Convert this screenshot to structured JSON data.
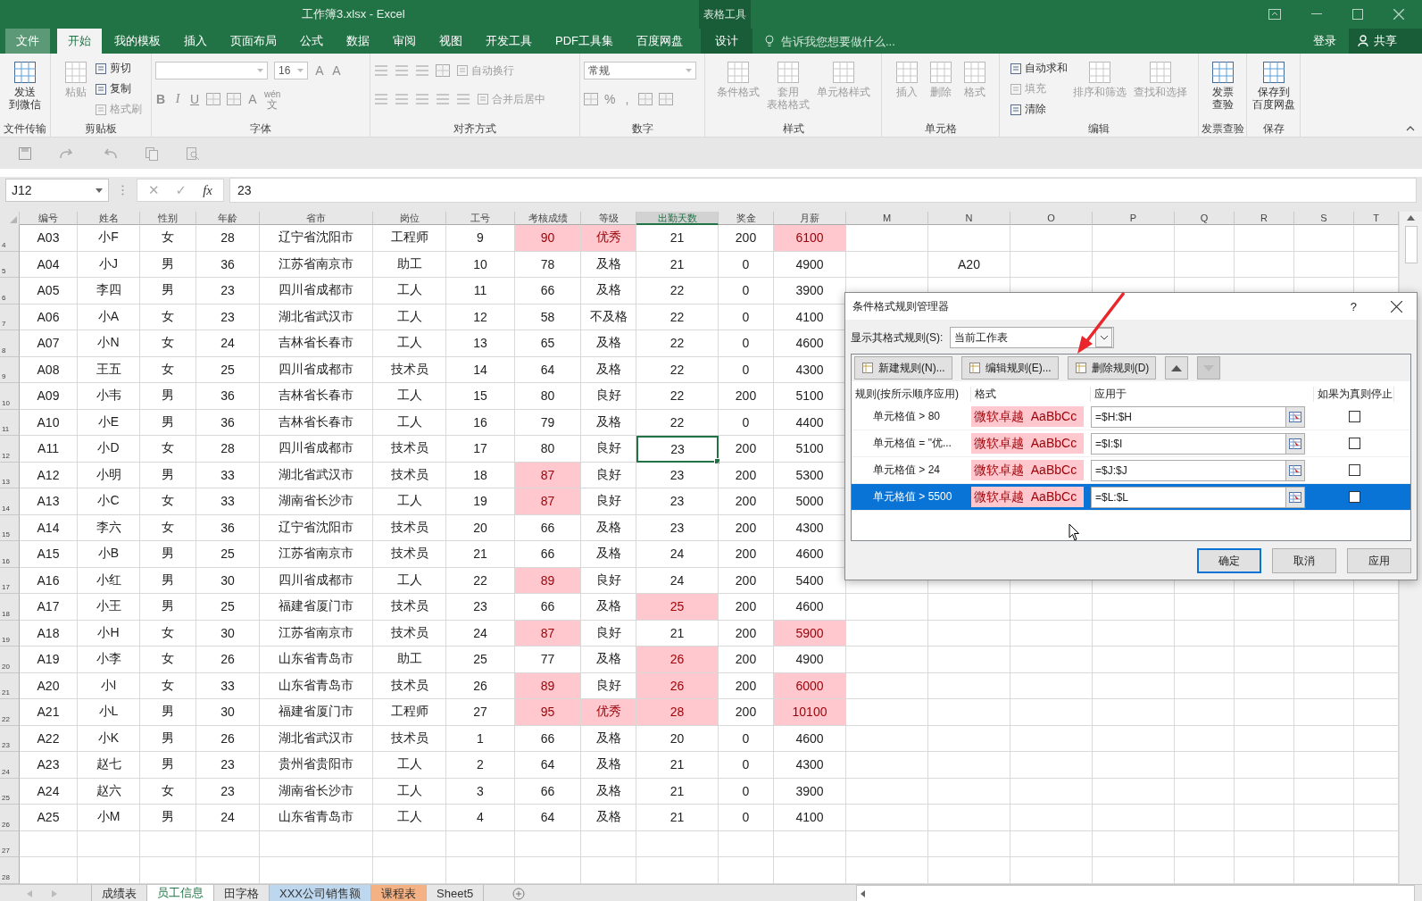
{
  "window": {
    "title": "工作簿3.xlsx - Excel",
    "context_label": "表格工具"
  },
  "ribbon_tabs": [
    {
      "label": "文件",
      "kind": "file",
      "selected": false
    },
    {
      "label": "开始",
      "kind": "tab",
      "selected": true
    },
    {
      "label": "我的模板",
      "kind": "tab",
      "selected": false
    },
    {
      "label": "插入",
      "kind": "tab",
      "selected": false
    },
    {
      "label": "页面布局",
      "kind": "tab",
      "selected": false
    },
    {
      "label": "公式",
      "kind": "tab",
      "selected": false
    },
    {
      "label": "数据",
      "kind": "tab",
      "selected": false
    },
    {
      "label": "审阅",
      "kind": "tab",
      "selected": false
    },
    {
      "label": "视图",
      "kind": "tab",
      "selected": false
    },
    {
      "label": "开发工具",
      "kind": "tab",
      "selected": false
    },
    {
      "label": "PDF工具集",
      "kind": "tab",
      "selected": false
    },
    {
      "label": "百度网盘",
      "kind": "tab",
      "selected": false
    },
    {
      "label": "设计",
      "kind": "context",
      "selected": false
    }
  ],
  "tell_me": {
    "placeholder": "告诉我您想要做什么..."
  },
  "account": {
    "login": "登录",
    "share": "共享"
  },
  "ribbon_groups": [
    {
      "label": "文件传输",
      "items": [
        {
          "kind": "large",
          "lines": [
            "发送",
            "到微信"
          ],
          "disabled": false
        }
      ]
    },
    {
      "label": "剪贴板",
      "items": [
        {
          "kind": "large",
          "lines": [
            "粘贴"
          ],
          "disabled": true
        },
        {
          "kind": "small",
          "label": "剪切",
          "disabled": false
        },
        {
          "kind": "small",
          "label": "复制",
          "disabled": false
        },
        {
          "kind": "small",
          "label": "格式刷",
          "disabled": true
        }
      ]
    },
    {
      "label": "字体",
      "rows": [
        [
          {
            "kind": "wide-field"
          },
          {
            "kind": "narrow-field",
            "value": "16"
          },
          {
            "kind": "glyph",
            "label": "A"
          },
          {
            "kind": "glyph",
            "label": "A"
          }
        ],
        [
          {
            "kind": "bold",
            "label": "B"
          },
          {
            "kind": "italic",
            "label": "I"
          },
          {
            "kind": "underline",
            "label": "U"
          },
          {
            "kind": "grid"
          },
          {
            "kind": "grid"
          },
          {
            "kind": "glyph",
            "label": "A"
          },
          {
            "kind": "phonetic",
            "lines": [
              "wén",
              "文"
            ]
          }
        ]
      ]
    },
    {
      "label": "对齐方式",
      "rows": [
        [
          {
            "kind": "lines"
          },
          {
            "kind": "lines"
          },
          {
            "kind": "lines"
          },
          {
            "kind": "grid"
          },
          {
            "kind": "small",
            "label": "自动换行",
            "disabled": true
          }
        ],
        [
          {
            "kind": "lines"
          },
          {
            "kind": "lines"
          },
          {
            "kind": "lines"
          },
          {
            "kind": "lines"
          },
          {
            "kind": "lines"
          },
          {
            "kind": "small",
            "label": "合并后居中",
            "disabled": true
          }
        ]
      ]
    },
    {
      "label": "数字",
      "rows": [
        [
          {
            "kind": "wide-field",
            "value": "常规"
          }
        ],
        [
          {
            "kind": "grid"
          },
          {
            "kind": "glyph",
            "label": "%"
          },
          {
            "kind": "glyph",
            "label": ","
          },
          {
            "kind": "grid"
          },
          {
            "kind": "grid"
          }
        ]
      ]
    },
    {
      "label": "样式",
      "items": [
        {
          "kind": "large",
          "lines": [
            "条件格式"
          ],
          "disabled": true
        },
        {
          "kind": "large",
          "lines": [
            "套用",
            "表格格式"
          ],
          "disabled": true
        },
        {
          "kind": "large",
          "lines": [
            "单元格样式"
          ],
          "disabled": true
        }
      ]
    },
    {
      "label": "单元格",
      "items": [
        {
          "kind": "large",
          "lines": [
            "插入"
          ],
          "disabled": true
        },
        {
          "kind": "large",
          "lines": [
            "删除"
          ],
          "disabled": true
        },
        {
          "kind": "large",
          "lines": [
            "格式"
          ],
          "disabled": true
        }
      ]
    },
    {
      "label": "编辑",
      "items": [
        {
          "kind": "small",
          "label": "自动求和",
          "disabled": false
        },
        {
          "kind": "small",
          "label": "填充",
          "disabled": true
        },
        {
          "kind": "small",
          "label": "清除",
          "disabled": false
        },
        {
          "kind": "large",
          "lines": [
            "排序和筛选"
          ],
          "disabled": true
        },
        {
          "kind": "large",
          "lines": [
            "查找和选择"
          ],
          "disabled": true
        }
      ]
    },
    {
      "label": "发票查验",
      "items": [
        {
          "kind": "large",
          "lines": [
            "发票",
            "查验"
          ],
          "disabled": false
        }
      ]
    },
    {
      "label": "保存",
      "items": [
        {
          "kind": "large",
          "lines": [
            "保存到",
            "百度网盘"
          ],
          "disabled": false
        }
      ]
    }
  ],
  "formula_bar": {
    "name_box": "J12",
    "cancel": "✕",
    "enter": "✓",
    "function": "fx",
    "value": "23"
  },
  "columns": [
    {
      "label": "编号",
      "selected": false
    },
    {
      "label": "姓名",
      "selected": false
    },
    {
      "label": "性别",
      "selected": false
    },
    {
      "label": "年龄",
      "selected": false
    },
    {
      "label": "省市",
      "selected": false
    },
    {
      "label": "岗位",
      "selected": false
    },
    {
      "label": "工号",
      "selected": false
    },
    {
      "label": "考核成绩",
      "selected": false
    },
    {
      "label": "等级",
      "selected": false
    },
    {
      "label": "出勤天数",
      "selected": true
    },
    {
      "label": "奖金",
      "selected": false
    },
    {
      "label": "月薪",
      "selected": false
    },
    {
      "label": "M",
      "selected": false
    },
    {
      "label": "N",
      "selected": false
    },
    {
      "label": "O",
      "selected": false
    },
    {
      "label": "P",
      "selected": false
    },
    {
      "label": "Q",
      "selected": false
    },
    {
      "label": "R",
      "selected": false
    },
    {
      "label": "S",
      "selected": false
    },
    {
      "label": "T",
      "selected": false
    }
  ],
  "rows": [
    {
      "number": "4",
      "cells": [
        "A03",
        "小F",
        "女",
        "28",
        "辽宁省沈阳市",
        "工程师",
        "9",
        "90",
        "优秀",
        "21",
        "200",
        "6100"
      ],
      "highlighted": [
        false,
        false,
        false,
        false,
        false,
        false,
        false,
        true,
        true,
        false,
        false,
        true
      ],
      "selected": [
        false,
        false,
        false,
        false,
        false,
        false,
        false,
        false,
        false,
        false,
        false,
        false
      ]
    },
    {
      "number": "5",
      "cells": [
        "A04",
        "小J",
        "男",
        "36",
        "江苏省南京市",
        "助工",
        "10",
        "78",
        "及格",
        "21",
        "0",
        "4900"
      ],
      "highlighted": [
        false,
        false,
        false,
        false,
        false,
        false,
        false,
        false,
        false,
        false,
        false,
        false
      ],
      "selected": [
        false,
        false,
        false,
        false,
        false,
        false,
        false,
        false,
        false,
        false,
        false,
        false
      ],
      "column_n": "A20"
    },
    {
      "number": "6",
      "cells": [
        "A05",
        "李四",
        "男",
        "23",
        "四川省成都市",
        "工人",
        "11",
        "66",
        "及格",
        "22",
        "0",
        "3900"
      ],
      "highlighted": [
        false,
        false,
        false,
        false,
        false,
        false,
        false,
        false,
        false,
        false,
        false,
        false
      ],
      "selected": [
        false,
        false,
        false,
        false,
        false,
        false,
        false,
        false,
        false,
        false,
        false,
        false
      ]
    },
    {
      "number": "7",
      "cells": [
        "A06",
        "小A",
        "女",
        "23",
        "湖北省武汉市",
        "工人",
        "12",
        "58",
        "不及格",
        "22",
        "0",
        "4100"
      ],
      "highlighted": [
        false,
        false,
        false,
        false,
        false,
        false,
        false,
        false,
        false,
        false,
        false,
        false
      ],
      "selected": [
        false,
        false,
        false,
        false,
        false,
        false,
        false,
        false,
        false,
        false,
        false,
        false
      ]
    },
    {
      "number": "8",
      "cells": [
        "A07",
        "小N",
        "女",
        "24",
        "吉林省长春市",
        "工人",
        "13",
        "65",
        "及格",
        "22",
        "0",
        "4600"
      ],
      "highlighted": [
        false,
        false,
        false,
        false,
        false,
        false,
        false,
        false,
        false,
        false,
        false,
        false
      ],
      "selected": [
        false,
        false,
        false,
        false,
        false,
        false,
        false,
        false,
        false,
        false,
        false,
        false
      ]
    },
    {
      "number": "9",
      "cells": [
        "A08",
        "王五",
        "女",
        "25",
        "四川省成都市",
        "技术员",
        "14",
        "64",
        "及格",
        "22",
        "0",
        "4300"
      ],
      "highlighted": [
        false,
        false,
        false,
        false,
        false,
        false,
        false,
        false,
        false,
        false,
        false,
        false
      ],
      "selected": [
        false,
        false,
        false,
        false,
        false,
        false,
        false,
        false,
        false,
        false,
        false,
        false
      ]
    },
    {
      "number": "10",
      "cells": [
        "A09",
        "小韦",
        "男",
        "36",
        "吉林省长春市",
        "工人",
        "15",
        "80",
        "良好",
        "22",
        "200",
        "5100"
      ],
      "highlighted": [
        false,
        false,
        false,
        false,
        false,
        false,
        false,
        false,
        false,
        false,
        false,
        false
      ],
      "selected": [
        false,
        false,
        false,
        false,
        false,
        false,
        false,
        false,
        false,
        false,
        false,
        false
      ]
    },
    {
      "number": "11",
      "cells": [
        "A10",
        "小E",
        "男",
        "36",
        "吉林省长春市",
        "工人",
        "16",
        "79",
        "及格",
        "22",
        "0",
        "4400"
      ],
      "highlighted": [
        false,
        false,
        false,
        false,
        false,
        false,
        false,
        false,
        false,
        false,
        false,
        false
      ],
      "selected": [
        false,
        false,
        false,
        false,
        false,
        false,
        false,
        false,
        false,
        false,
        false,
        false
      ]
    },
    {
      "number": "12",
      "cells": [
        "A11",
        "小D",
        "女",
        "28",
        "四川省成都市",
        "技术员",
        "17",
        "80",
        "良好",
        "23",
        "200",
        "5100"
      ],
      "highlighted": [
        false,
        false,
        false,
        false,
        false,
        false,
        false,
        false,
        false,
        false,
        false,
        false
      ],
      "selected": [
        false,
        false,
        false,
        false,
        false,
        false,
        false,
        false,
        false,
        true,
        false,
        false
      ]
    },
    {
      "number": "13",
      "cells": [
        "A12",
        "小明",
        "男",
        "33",
        "湖北省武汉市",
        "技术员",
        "18",
        "87",
        "良好",
        "23",
        "200",
        "5300"
      ],
      "highlighted": [
        false,
        false,
        false,
        false,
        false,
        false,
        false,
        true,
        false,
        false,
        false,
        false
      ],
      "selected": [
        false,
        false,
        false,
        false,
        false,
        false,
        false,
        false,
        false,
        false,
        false,
        false
      ]
    },
    {
      "number": "14",
      "cells": [
        "A13",
        "小C",
        "女",
        "33",
        "湖南省长沙市",
        "工人",
        "19",
        "87",
        "良好",
        "23",
        "200",
        "5000"
      ],
      "highlighted": [
        false,
        false,
        false,
        false,
        false,
        false,
        false,
        true,
        false,
        false,
        false,
        false
      ],
      "selected": [
        false,
        false,
        false,
        false,
        false,
        false,
        false,
        false,
        false,
        false,
        false,
        false
      ]
    },
    {
      "number": "15",
      "cells": [
        "A14",
        "李六",
        "女",
        "36",
        "辽宁省沈阳市",
        "技术员",
        "20",
        "66",
        "及格",
        "23",
        "200",
        "4300"
      ],
      "highlighted": [
        false,
        false,
        false,
        false,
        false,
        false,
        false,
        false,
        false,
        false,
        false,
        false
      ],
      "selected": [
        false,
        false,
        false,
        false,
        false,
        false,
        false,
        false,
        false,
        false,
        false,
        false
      ]
    },
    {
      "number": "16",
      "cells": [
        "A15",
        "小B",
        "男",
        "25",
        "江苏省南京市",
        "技术员",
        "21",
        "66",
        "及格",
        "24",
        "200",
        "4600"
      ],
      "highlighted": [
        false,
        false,
        false,
        false,
        false,
        false,
        false,
        false,
        false,
        false,
        false,
        false
      ],
      "selected": [
        false,
        false,
        false,
        false,
        false,
        false,
        false,
        false,
        false,
        false,
        false,
        false
      ]
    },
    {
      "number": "17",
      "cells": [
        "A16",
        "小红",
        "男",
        "30",
        "四川省成都市",
        "工人",
        "22",
        "89",
        "良好",
        "24",
        "200",
        "5400"
      ],
      "highlighted": [
        false,
        false,
        false,
        false,
        false,
        false,
        false,
        true,
        false,
        false,
        false,
        false
      ],
      "selected": [
        false,
        false,
        false,
        false,
        false,
        false,
        false,
        false,
        false,
        false,
        false,
        false
      ]
    },
    {
      "number": "18",
      "cells": [
        "A17",
        "小王",
        "男",
        "25",
        "福建省厦门市",
        "技术员",
        "23",
        "66",
        "及格",
        "25",
        "200",
        "4600"
      ],
      "highlighted": [
        false,
        false,
        false,
        false,
        false,
        false,
        false,
        false,
        false,
        true,
        false,
        false
      ],
      "selected": [
        false,
        false,
        false,
        false,
        false,
        false,
        false,
        false,
        false,
        false,
        false,
        false
      ]
    },
    {
      "number": "19",
      "cells": [
        "A18",
        "小H",
        "女",
        "30",
        "江苏省南京市",
        "技术员",
        "24",
        "87",
        "良好",
        "21",
        "200",
        "5900"
      ],
      "highlighted": [
        false,
        false,
        false,
        false,
        false,
        false,
        false,
        true,
        false,
        false,
        false,
        true
      ],
      "selected": [
        false,
        false,
        false,
        false,
        false,
        false,
        false,
        false,
        false,
        false,
        false,
        false
      ]
    },
    {
      "number": "20",
      "cells": [
        "A19",
        "小李",
        "女",
        "26",
        "山东省青岛市",
        "助工",
        "25",
        "77",
        "及格",
        "26",
        "200",
        "4900"
      ],
      "highlighted": [
        false,
        false,
        false,
        false,
        false,
        false,
        false,
        false,
        false,
        true,
        false,
        false
      ],
      "selected": [
        false,
        false,
        false,
        false,
        false,
        false,
        false,
        false,
        false,
        false,
        false,
        false
      ]
    },
    {
      "number": "21",
      "cells": [
        "A20",
        "小I",
        "女",
        "33",
        "山东省青岛市",
        "技术员",
        "26",
        "89",
        "良好",
        "26",
        "200",
        "6000"
      ],
      "highlighted": [
        false,
        false,
        false,
        false,
        false,
        false,
        false,
        true,
        false,
        true,
        false,
        true
      ],
      "selected": [
        false,
        false,
        false,
        false,
        false,
        false,
        false,
        false,
        false,
        false,
        false,
        false
      ]
    },
    {
      "number": "22",
      "cells": [
        "A21",
        "小L",
        "男",
        "30",
        "福建省厦门市",
        "工程师",
        "27",
        "95",
        "优秀",
        "28",
        "200",
        "10100"
      ],
      "highlighted": [
        false,
        false,
        false,
        false,
        false,
        false,
        false,
        true,
        true,
        true,
        false,
        true
      ],
      "selected": [
        false,
        false,
        false,
        false,
        false,
        false,
        false,
        false,
        false,
        false,
        false,
        false
      ]
    },
    {
      "number": "23",
      "cells": [
        "A22",
        "小K",
        "男",
        "26",
        "湖北省武汉市",
        "技术员",
        "1",
        "66",
        "及格",
        "20",
        "0",
        "4600"
      ],
      "highlighted": [
        false,
        false,
        false,
        false,
        false,
        false,
        false,
        false,
        false,
        false,
        false,
        false
      ],
      "selected": [
        false,
        false,
        false,
        false,
        false,
        false,
        false,
        false,
        false,
        false,
        false,
        false
      ]
    },
    {
      "number": "24",
      "cells": [
        "A23",
        "赵七",
        "男",
        "23",
        "贵州省贵阳市",
        "工人",
        "2",
        "64",
        "及格",
        "21",
        "0",
        "4300"
      ],
      "highlighted": [
        false,
        false,
        false,
        false,
        false,
        false,
        false,
        false,
        false,
        false,
        false,
        false
      ],
      "selected": [
        false,
        false,
        false,
        false,
        false,
        false,
        false,
        false,
        false,
        false,
        false,
        false
      ]
    },
    {
      "number": "25",
      "cells": [
        "A24",
        "赵六",
        "女",
        "23",
        "湖南省长沙市",
        "工人",
        "3",
        "66",
        "及格",
        "21",
        "0",
        "3900"
      ],
      "highlighted": [
        false,
        false,
        false,
        false,
        false,
        false,
        false,
        false,
        false,
        false,
        false,
        false
      ],
      "selected": [
        false,
        false,
        false,
        false,
        false,
        false,
        false,
        false,
        false,
        false,
        false,
        false
      ]
    },
    {
      "number": "26",
      "cells": [
        "A25",
        "小M",
        "男",
        "24",
        "山东省青岛市",
        "工人",
        "4",
        "64",
        "及格",
        "21",
        "0",
        "4100"
      ],
      "highlighted": [
        false,
        false,
        false,
        false,
        false,
        false,
        false,
        false,
        false,
        false,
        false,
        false
      ],
      "selected": [
        false,
        false,
        false,
        false,
        false,
        false,
        false,
        false,
        false,
        false,
        false,
        false
      ]
    },
    {
      "number": "27"
    },
    {
      "number": "28"
    }
  ],
  "sheet_tabs": [
    {
      "label": "成绩表",
      "selected": false
    },
    {
      "label": "员工信息",
      "selected": true
    },
    {
      "label": "田字格",
      "selected": false
    },
    {
      "label": "XXX公司销售额",
      "selected": false,
      "color": "#bdd7ee"
    },
    {
      "label": "课程表",
      "selected": false,
      "color": "#f4b183"
    },
    {
      "label": "Sheet5",
      "selected": false
    }
  ],
  "dialog": {
    "title": "条件格式规则管理器",
    "help": "?",
    "show_label": "显示其格式规则(S):",
    "show_value": "当前工作表",
    "buttons": [
      {
        "label": "新建规则(N)...",
        "disabled": false
      },
      {
        "label": "编辑规则(E)...",
        "disabled": false
      },
      {
        "label": "删除规则(D)",
        "disabled": false
      }
    ],
    "move_up_disabled": false,
    "move_down_disabled": true,
    "headers": [
      "规则(按所示顺序应用)",
      "格式",
      "应用于",
      "如果为真则停止"
    ],
    "rules": [
      {
        "rule": "单元格值 > 80",
        "preview": "微软卓越  AaBbCc",
        "applies_to": "=$H:$H",
        "stop": false,
        "selected": false
      },
      {
        "rule": "单元格值 = \"优...",
        "preview": "微软卓越  AaBbCc",
        "applies_to": "=$I:$I",
        "stop": false,
        "selected": false
      },
      {
        "rule": "单元格值 > 24",
        "preview": "微软卓越  AaBbCc",
        "applies_to": "=$J:$J",
        "stop": false,
        "selected": false
      },
      {
        "rule": "单元格值 > 5500",
        "preview": "微软卓越  AaBbCc",
        "applies_to": "=$L:$L",
        "stop": false,
        "selected": true
      }
    ],
    "footer_buttons": [
      {
        "label": "确定",
        "default": true
      },
      {
        "label": "取消",
        "default": false
      },
      {
        "label": "应用",
        "default": false
      }
    ]
  }
}
